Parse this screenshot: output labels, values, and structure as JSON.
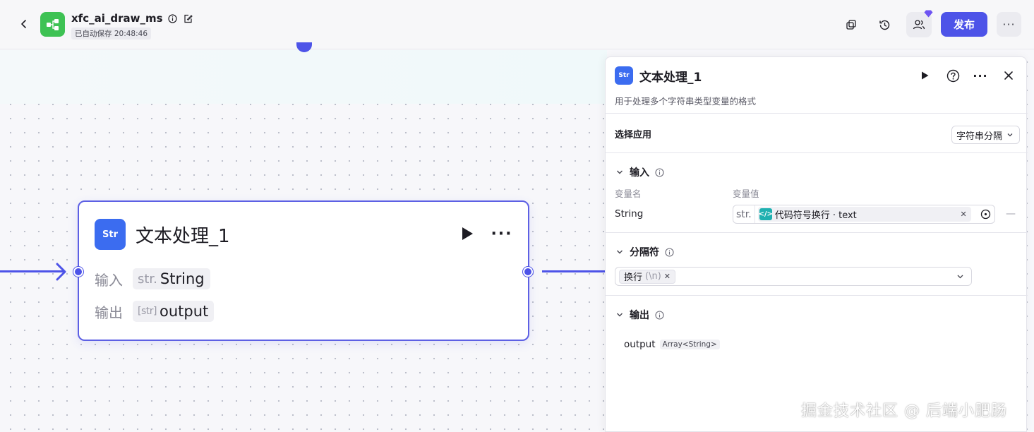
{
  "header": {
    "app_name": "xfc_ai_draw_ms",
    "autosave_text": "已自动保存 20:48:46",
    "publish_label": "发布",
    "more_label": "···"
  },
  "node": {
    "icon_text": "Str",
    "title": "文本处理_1",
    "input_label": "输入",
    "input_prefix": "str.",
    "input_value": "String",
    "output_label": "输出",
    "output_prefix": "[str]",
    "output_value": "output",
    "more_label": "···"
  },
  "panel": {
    "icon_text": "Str",
    "title": "文本处理_1",
    "description": "用于处理多个字符串类型变量的格式",
    "select_app_label": "选择应用",
    "select_app_value": "字符串分隔",
    "input_section": "输入",
    "col_var_name": "变量名",
    "col_var_value": "变量值",
    "var_name": "String",
    "var_prefix": "str.",
    "var_ref": "代码符号换行 · text",
    "var_clear": "✕",
    "var_remove": "—",
    "separator_section": "分隔符",
    "separator_tag": "换行",
    "separator_escape": "(\\n)",
    "separator_tag_remove": "✕",
    "output_section": "输出",
    "output_name": "output",
    "output_type": "Array<String>",
    "more_label": "···"
  },
  "watermark": "掘金技术社区 @ 后端小肥肠",
  "colors": {
    "accent": "#4d53e8",
    "node_icon": "#3b6cf0",
    "app_logo": "#3ec254",
    "code_icon": "#1fb0b0"
  }
}
